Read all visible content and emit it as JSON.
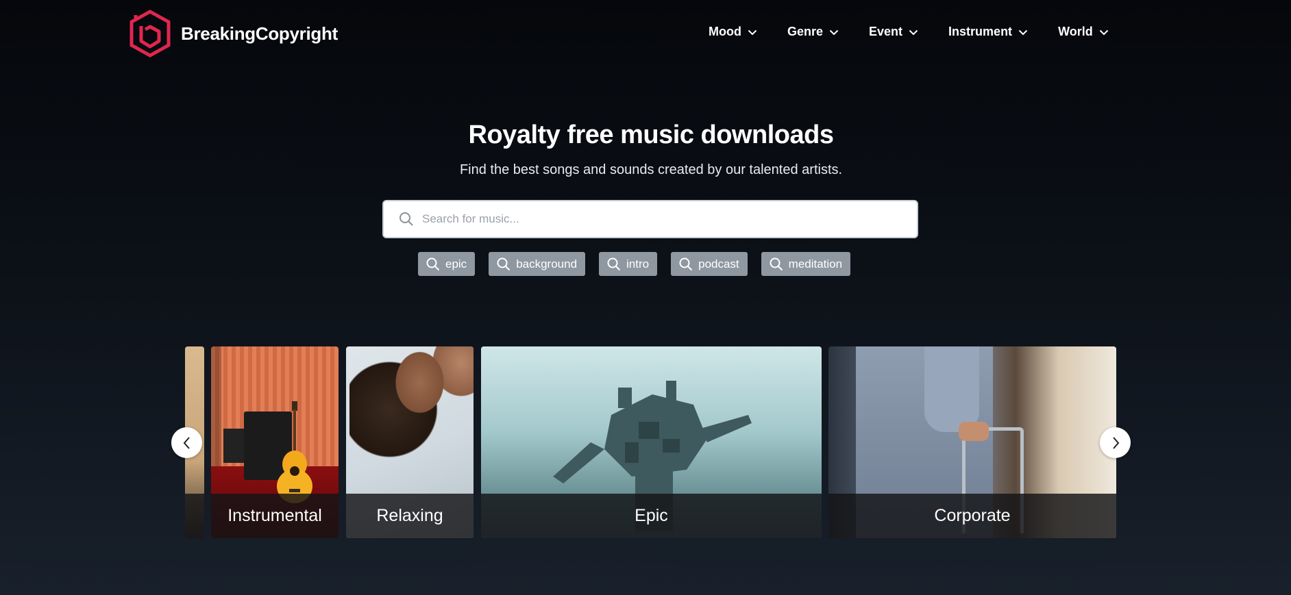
{
  "brand": {
    "name": "BreakingCopyright",
    "logo_color": "#e0264f"
  },
  "nav": {
    "items": [
      {
        "label": "Mood"
      },
      {
        "label": "Genre"
      },
      {
        "label": "Event"
      },
      {
        "label": "Instrument"
      },
      {
        "label": "World"
      }
    ]
  },
  "hero": {
    "title": "Royalty free music downloads",
    "subtitle": "Find the best songs and sounds created by our talented artists."
  },
  "search": {
    "placeholder": "Search for music...",
    "value": ""
  },
  "tags": [
    {
      "label": "epic"
    },
    {
      "label": "background"
    },
    {
      "label": "intro"
    },
    {
      "label": "podcast"
    },
    {
      "label": "meditation"
    }
  ],
  "carousel": {
    "cards": [
      {
        "label": ""
      },
      {
        "label": "Instrumental"
      },
      {
        "label": "Relaxing"
      },
      {
        "label": "Epic"
      },
      {
        "label": "Corporate"
      }
    ],
    "prev_icon": "chevron-left-icon",
    "next_icon": "chevron-right-icon"
  }
}
